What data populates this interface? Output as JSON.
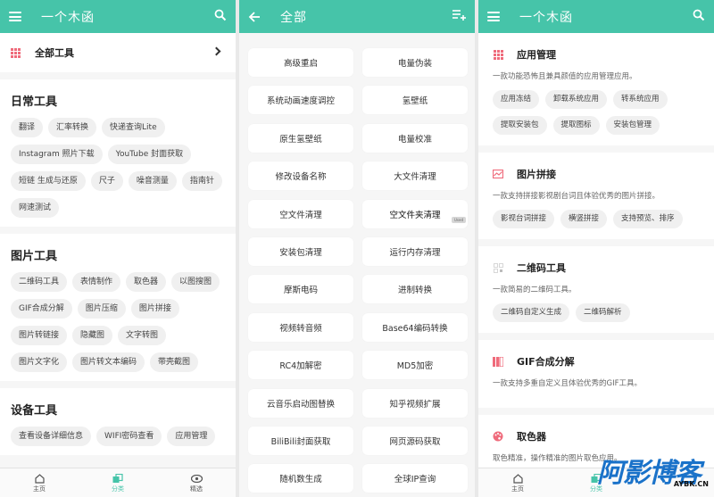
{
  "colors": {
    "accent": "#46c4a9",
    "icon_pink": "#ef6b7b",
    "watermark_blue": "#1a72c9"
  },
  "panel_home": {
    "title": "一个木函",
    "all_tools_label": "全部工具",
    "sections": [
      {
        "title": "日常工具",
        "chips": [
          "翻译",
          "汇率转换",
          "快递查询Lite",
          "Instagram 照片下载",
          "YouTube 封面获取",
          "短链 生成与还原",
          "尺子",
          "噪音测量",
          "指南针",
          "网速测试"
        ]
      },
      {
        "title": "图片工具",
        "chips": [
          "二维码工具",
          "表情制作",
          "取色器",
          "以图搜图",
          "GIF合成分解",
          "图片压缩",
          "图片拼接",
          "图片转链接",
          "隐藏图",
          "文字转图",
          "图片文字化",
          "图片转文本编码",
          "带壳截图"
        ]
      },
      {
        "title": "设备工具",
        "chips": [
          "查看设备详细信息",
          "WIFI密码查看",
          "应用管理"
        ]
      }
    ],
    "bottom_nav": [
      {
        "label": "主页",
        "icon": "home-icon"
      },
      {
        "label": "分类",
        "icon": "category-icon"
      },
      {
        "label": "精选",
        "icon": "eye-icon"
      }
    ]
  },
  "panel_all": {
    "title": "全部",
    "used_tag": "Used",
    "tools": [
      "高级重启",
      "电量伪装",
      "系统动画速度调控",
      "氢壁纸",
      "原生氢壁纸",
      "电量校准",
      "修改设备名称",
      "大文件清理",
      "空文件清理",
      "空文件夹清理",
      "安装包清理",
      "运行内存清理",
      "摩斯电码",
      "进制转换",
      "视频转音频",
      "Base64编码转换",
      "RC4加解密",
      "MD5加密",
      "云音乐启动图替换",
      "知乎视频扩展",
      "BiliBili封面获取",
      "网页源码获取",
      "随机数生成",
      "全球IP查询"
    ]
  },
  "panel_detail": {
    "title": "一个木函",
    "cards": [
      {
        "title": "应用管理",
        "icon": "grid-icon",
        "desc": "一款功能恐怖且兼具颜值的应用管理应用。",
        "chips": [
          "应用冻结",
          "卸载系统应用",
          "转系统应用",
          "提取安装包",
          "提取图标",
          "安装包管理"
        ]
      },
      {
        "title": "图片拼接",
        "icon": "image-stitch-icon",
        "desc": "一款支持拼接影视剧台词且体验优秀的图片拼接。",
        "chips": [
          "影视台词拼接",
          "横竖拼接",
          "支持预览、排序"
        ]
      },
      {
        "title": "二维码工具",
        "icon": "qrcode-icon",
        "desc": "一款简易的二维码工具。",
        "chips": [
          "二维码自定义生成",
          "二维码解析"
        ]
      },
      {
        "title": "GIF合成分解",
        "icon": "gif-icon",
        "desc": "一款支持多重自定义且体验优秀的GIF工具。",
        "chips": []
      },
      {
        "title": "取色器",
        "icon": "palette-icon",
        "desc": "取色精准，操作精准的图片取色应用。",
        "chips": []
      }
    ],
    "bottom_nav": [
      {
        "label": "主页",
        "icon": "home-icon"
      },
      {
        "label": "分类",
        "icon": "category-icon"
      }
    ],
    "watermark_big": "阿影博客",
    "watermark_small": "AYBK.CN"
  }
}
